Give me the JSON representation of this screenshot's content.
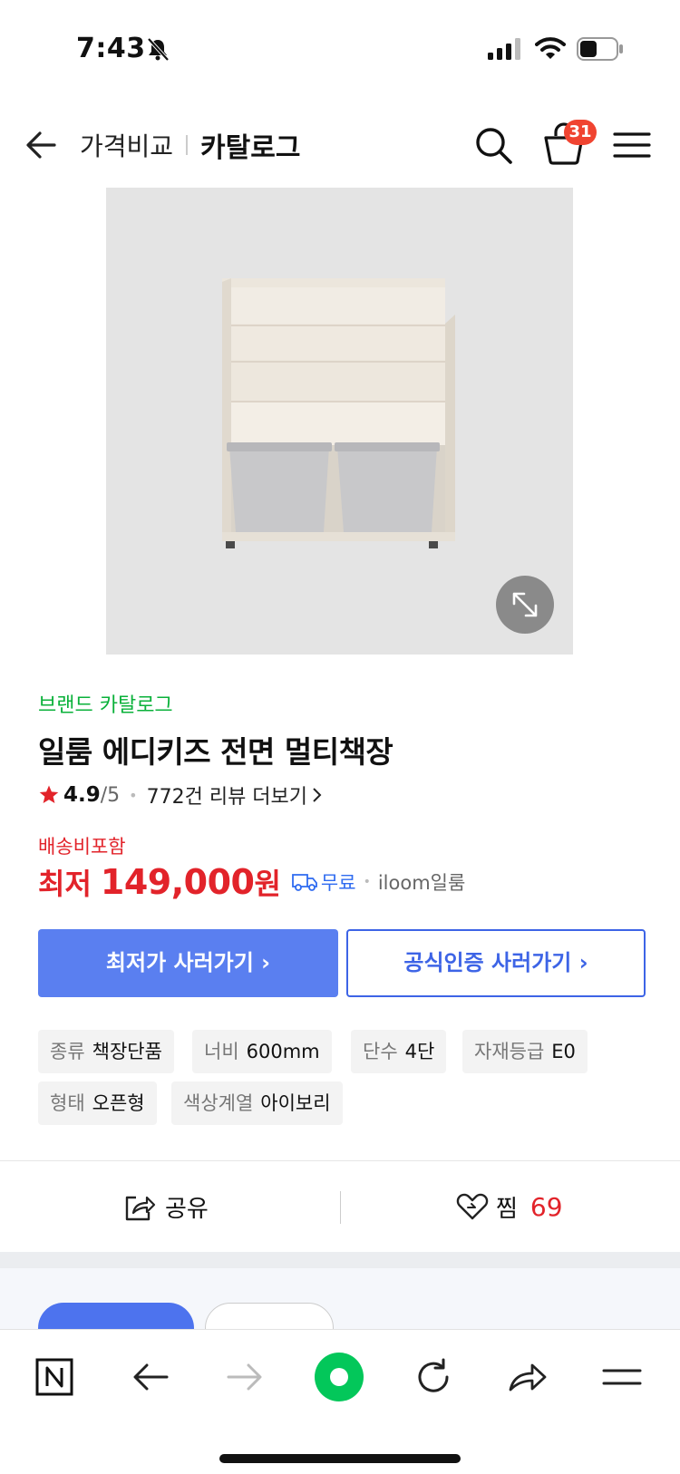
{
  "status_bar": {
    "time": "7:43"
  },
  "header": {
    "left_title": "가격비교",
    "right_title": "카탈로그",
    "cart_count": "31"
  },
  "product": {
    "brand_catalog": "브랜드 카탈로그",
    "title": "일룸 에디키즈 전면 멀티책장",
    "rating": "4.9",
    "rating_max": "/5",
    "reviews": "772건 리뷰 더보기",
    "shipping_included": "배송비포함",
    "lowest_label": "최저",
    "price": "149,000",
    "currency": "원",
    "shipping": "무료",
    "seller": "iloom일룸"
  },
  "buttons": {
    "lowest": "최저가 사러가기 ›",
    "official": "공식인증 사러가기 ›"
  },
  "specs": [
    {
      "key": "종류",
      "value": "책장단품"
    },
    {
      "key": "너비",
      "value": "600mm"
    },
    {
      "key": "단수",
      "value": "4단"
    },
    {
      "key": "자재등급",
      "value": "E0"
    },
    {
      "key": "형태",
      "value": "오픈형"
    },
    {
      "key": "색상계열",
      "value": "아이보리"
    }
  ],
  "actions": {
    "share": "공유",
    "like": "찜",
    "like_count": "69"
  },
  "colors": {
    "accent_blue": "#5a7ff0",
    "outline_blue": "#3d64e6",
    "price_red": "#e2232a",
    "brand_green": "#0ab13a",
    "naver_green": "#03c75a"
  }
}
